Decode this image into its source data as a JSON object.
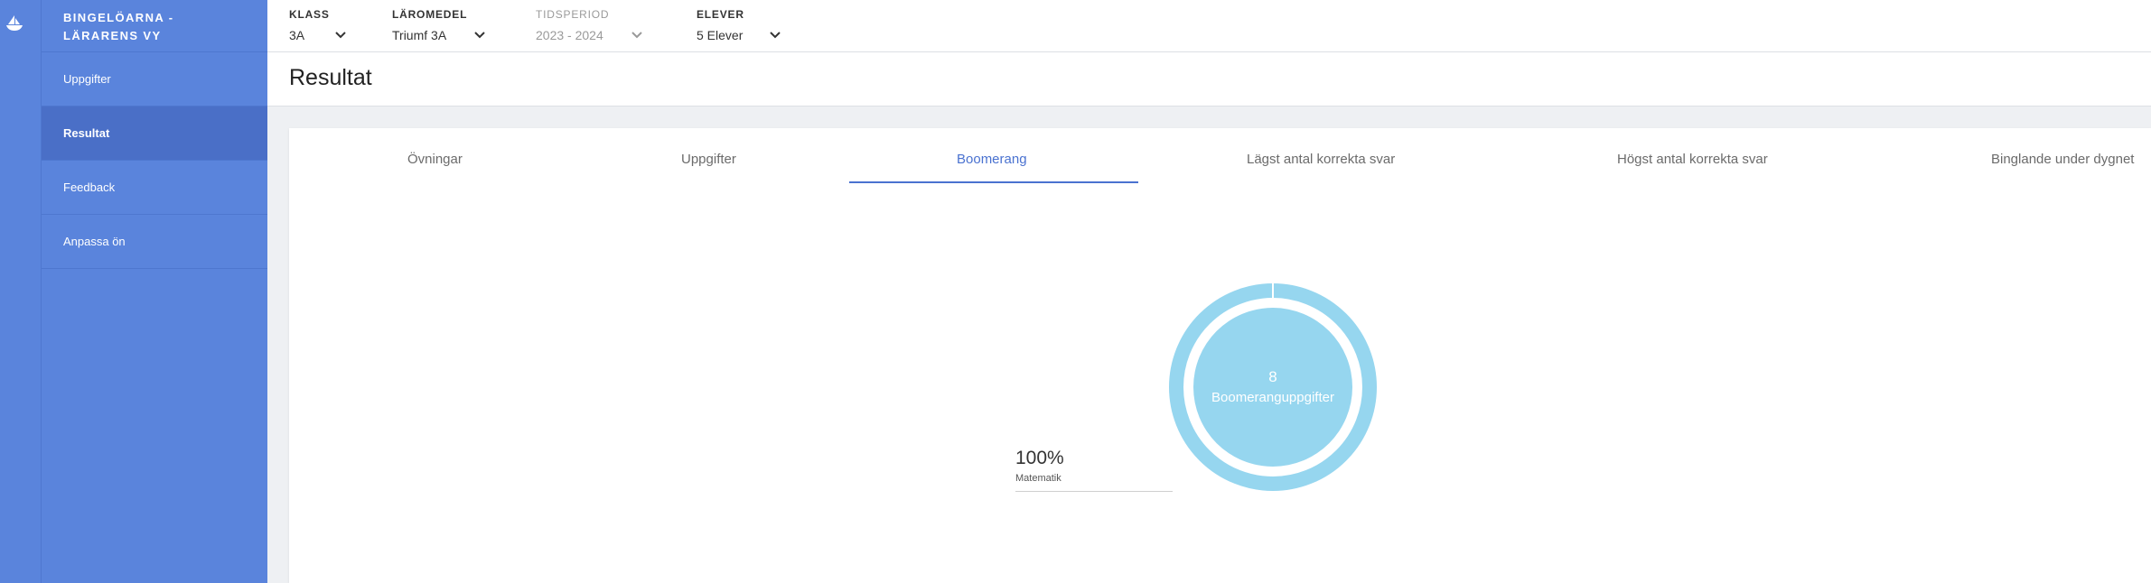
{
  "brand": {
    "title": "BINGELÖARNA - LÄRARENS VY"
  },
  "sidebar": {
    "items": [
      {
        "label": "Uppgifter"
      },
      {
        "label": "Resultat"
      },
      {
        "label": "Feedback"
      },
      {
        "label": "Anpassa ön"
      }
    ]
  },
  "filters": {
    "klass": {
      "label": "KLASS",
      "value": "3A"
    },
    "laromedel": {
      "label": "LÄROMEDEL",
      "value": "Triumf 3A"
    },
    "tidsperiod": {
      "label": "TIDSPERIOD",
      "value": "2023 - 2024"
    },
    "elever": {
      "label": "ELEVER",
      "value": "5 Elever"
    }
  },
  "page": {
    "title": "Resultat"
  },
  "tabs": [
    {
      "label": "Övningar"
    },
    {
      "label": "Uppgifter"
    },
    {
      "label": "Boomerang"
    },
    {
      "label": "Lägst antal korrekta svar"
    },
    {
      "label": "Högst antal korrekta svar"
    },
    {
      "label": "Binglande under dygnet"
    }
  ],
  "active_tab": "Boomerang",
  "donut": {
    "count": "8",
    "label": "Boomeranguppgifter",
    "color": "#96d6ef"
  },
  "legend": {
    "percent": "100%",
    "subject": "Matematik"
  },
  "colors": {
    "sidebar": "#5a84dc",
    "accent": "#4a72d0"
  }
}
